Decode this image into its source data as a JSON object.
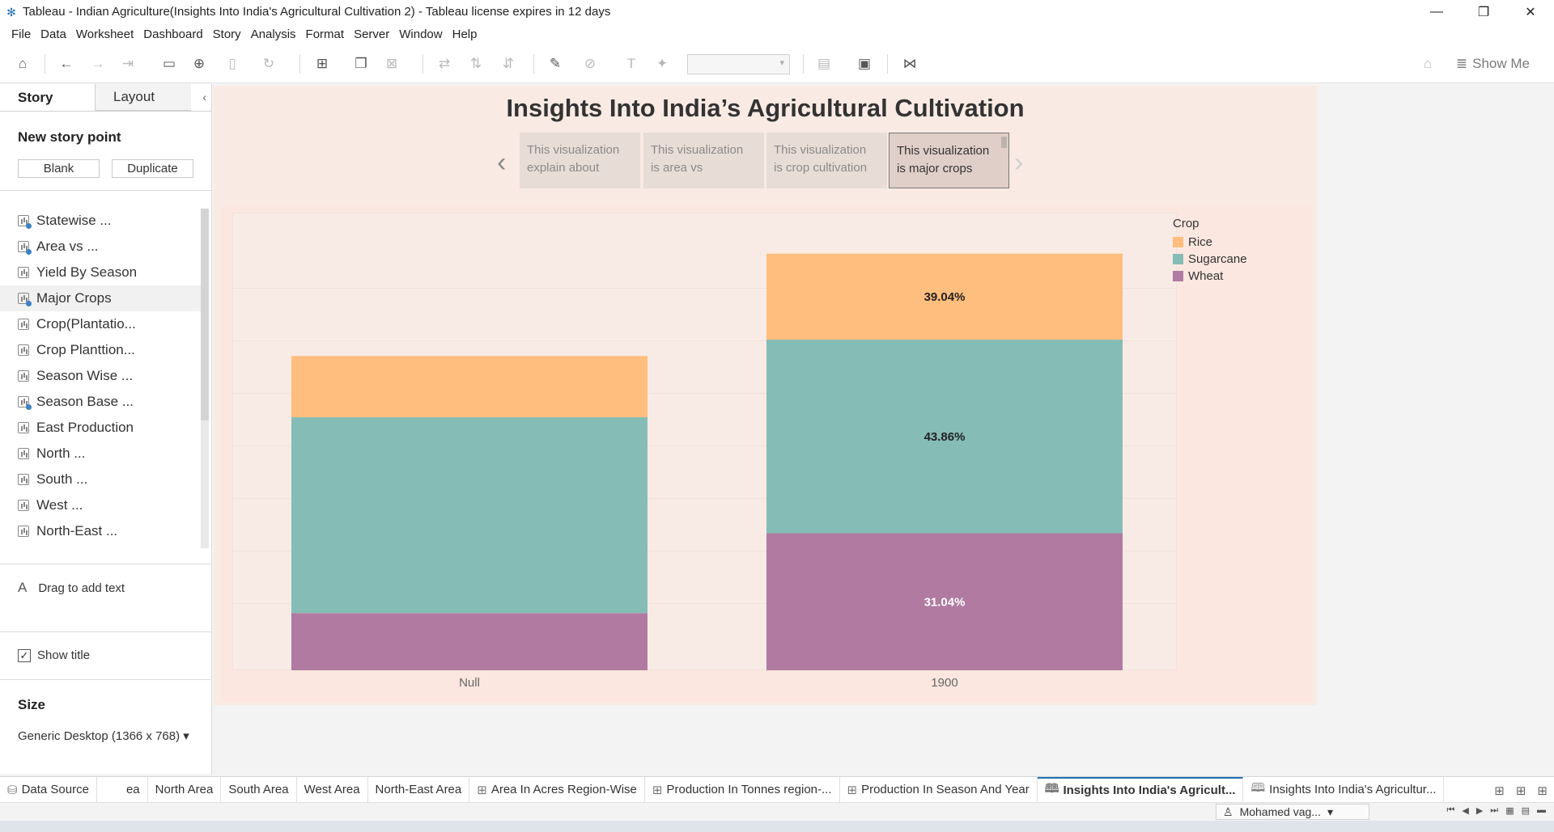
{
  "window": {
    "title": "Tableau - Indian Agriculture(Insights Into India's Agricultural Cultivation 2) - Tableau license expires in 12 days",
    "minimize": "—",
    "restore": "❐",
    "close": "✕"
  },
  "menu": [
    "File",
    "Data",
    "Worksheet",
    "Dashboard",
    "Story",
    "Analysis",
    "Format",
    "Server",
    "Window",
    "Help"
  ],
  "toolbar": {
    "show_me": "Show Me"
  },
  "left_pane": {
    "tabs": {
      "story": "Story",
      "layout": "Layout"
    },
    "new_story_point": "New story point",
    "blank_button": "Blank",
    "duplicate_button": "Duplicate",
    "sheets": [
      {
        "label": "Statewise ...",
        "dashboard": true
      },
      {
        "label": "Area vs ...",
        "dashboard": true
      },
      {
        "label": "Yield By Season",
        "dashboard": false
      },
      {
        "label": "Major Crops",
        "dashboard": true
      },
      {
        "label": "Crop(Plantatio...",
        "dashboard": false
      },
      {
        "label": "Crop Planttion...",
        "dashboard": false
      },
      {
        "label": "Season Wise ...",
        "dashboard": false
      },
      {
        "label": "Season Base ...",
        "dashboard": true
      },
      {
        "label": "East Production",
        "dashboard": false
      },
      {
        "label": "North ...",
        "dashboard": false
      },
      {
        "label": "South ...",
        "dashboard": false
      },
      {
        "label": "West ...",
        "dashboard": false
      },
      {
        "label": "North-East ...",
        "dashboard": false
      }
    ],
    "drag_text": "Drag to add text",
    "show_title": "Show title",
    "size_heading": "Size",
    "size_value": "Generic Desktop (1366 x 768)"
  },
  "story": {
    "title": "Insights Into India’s Agricultural Cultivation",
    "captions": [
      {
        "line1": "This visualization",
        "line2": "explain about",
        "active": false
      },
      {
        "line1": "This visualization",
        "line2": "is area vs",
        "active": false
      },
      {
        "line1": "This visualization",
        "line2": "is crop cultivation",
        "active": false
      },
      {
        "line1": "This visualization",
        "line2": "is major crops",
        "active": true
      }
    ]
  },
  "chart_data": {
    "type": "bar",
    "stacked": true,
    "percent_of_total": true,
    "categories": [
      "Null",
      "1900"
    ],
    "legend_title": "Crop",
    "legend_position": "right",
    "series": [
      {
        "name": "Wheat",
        "color": "#b07aa1",
        "values": [
          12.96,
          31.04
        ],
        "labels": [
          "",
          "31.04%"
        ],
        "label_color": "#ffffff"
      },
      {
        "name": "Sugarcane",
        "color": "#86bcb6",
        "values": [
          44.36,
          43.86
        ],
        "labels": [
          "",
          "43.86%"
        ],
        "label_color": "#222222"
      },
      {
        "name": "Rice",
        "color": "#ffbe7d",
        "values": [
          13.86,
          19.48
        ],
        "labels": [
          "",
          "39.04%"
        ],
        "label_color": "#222222"
      }
    ],
    "legend_order": [
      "Rice",
      "Sugarcane",
      "Wheat"
    ],
    "ylim": [
      0,
      100
    ],
    "grid": true
  },
  "sheet_tabs": [
    {
      "label": "Data Source",
      "icon": "database-icon",
      "glyph": "⛁",
      "active": false
    },
    {
      "label": "ea",
      "icon": "",
      "glyph": "",
      "active": false
    },
    {
      "label": "North Area",
      "icon": "",
      "glyph": "",
      "active": false
    },
    {
      "label": "South Area",
      "icon": "",
      "glyph": "",
      "active": false
    },
    {
      "label": "West Area",
      "icon": "",
      "glyph": "",
      "active": false
    },
    {
      "label": "North-East Area",
      "icon": "",
      "glyph": "",
      "active": false
    },
    {
      "label": "Area In Acres Region-Wise",
      "icon": "dashboard-icon",
      "glyph": "⊞",
      "active": false
    },
    {
      "label": "Production In Tonnes region-...",
      "icon": "dashboard-icon",
      "glyph": "⊞",
      "active": false
    },
    {
      "label": "Production In Season And Year",
      "icon": "dashboard-icon",
      "glyph": "⊞",
      "active": false
    },
    {
      "label": "Insights Into India's Agricult...",
      "icon": "story-icon",
      "glyph": "🕮",
      "active": true
    },
    {
      "label": "Insights Into India's Agricultur...",
      "icon": "story-icon",
      "glyph": "🕮",
      "active": false
    }
  ],
  "status": {
    "user": "Mohamed vag..."
  }
}
